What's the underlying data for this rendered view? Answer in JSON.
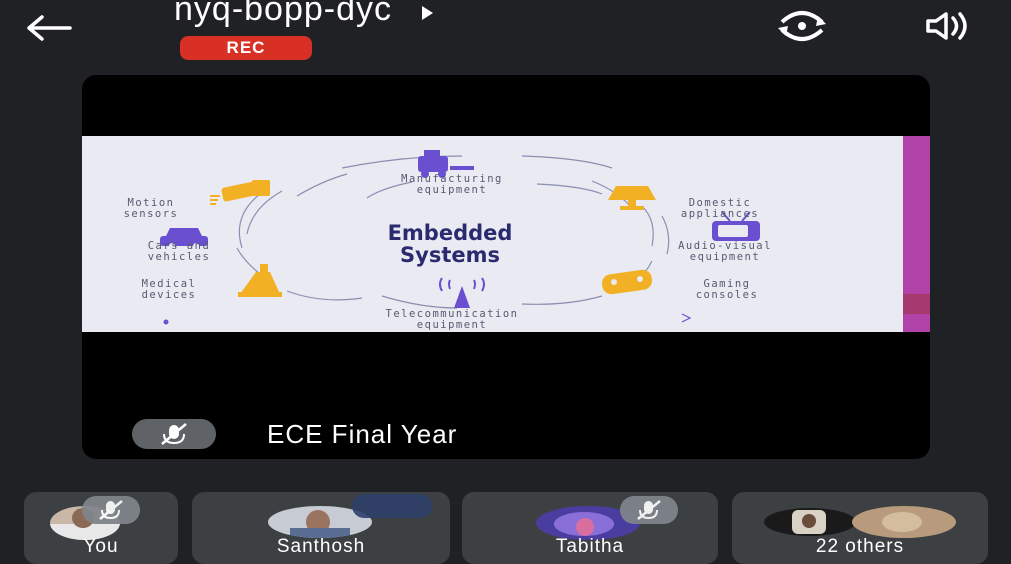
{
  "header": {
    "meeting_code": "nyq-bopp-dyc",
    "rec_label": "REC",
    "icons": [
      "back-arrow-icon",
      "play-caret-icon",
      "flip-camera-icon",
      "speaker-icon"
    ]
  },
  "slide": {
    "title_line1": "Embedded",
    "title_line2": "Systems",
    "labels": {
      "manufacturing": [
        "Manufacturing",
        "equipment"
      ],
      "domestic": [
        "Domestic",
        "appliances"
      ],
      "audio_visual": [
        "Audio-visual",
        "equipment"
      ],
      "gaming": [
        "Gaming",
        "consoles"
      ],
      "telecom": [
        "Telecommunication",
        "equipment"
      ],
      "medical": [
        "Medical",
        "devices"
      ],
      "cars": [
        "Cars and",
        "vehicles"
      ],
      "motion": [
        "Motion",
        "sensors"
      ]
    },
    "accent_color": "#f2b024",
    "icon_color": "#6a4fd0"
  },
  "presenter": {
    "name": "ECE Final Year",
    "mic_muted": true
  },
  "participants": [
    {
      "name": "You",
      "mic_muted": true
    },
    {
      "name": "Santhosh",
      "mic_muted": false
    },
    {
      "name": "Tabitha",
      "mic_muted": true
    },
    {
      "name": "22 others",
      "mic_muted": false
    }
  ],
  "colors": {
    "background": "#202124",
    "rec": "#d93025",
    "tile": "#3c4043",
    "slide_edge": "#b042a8"
  }
}
